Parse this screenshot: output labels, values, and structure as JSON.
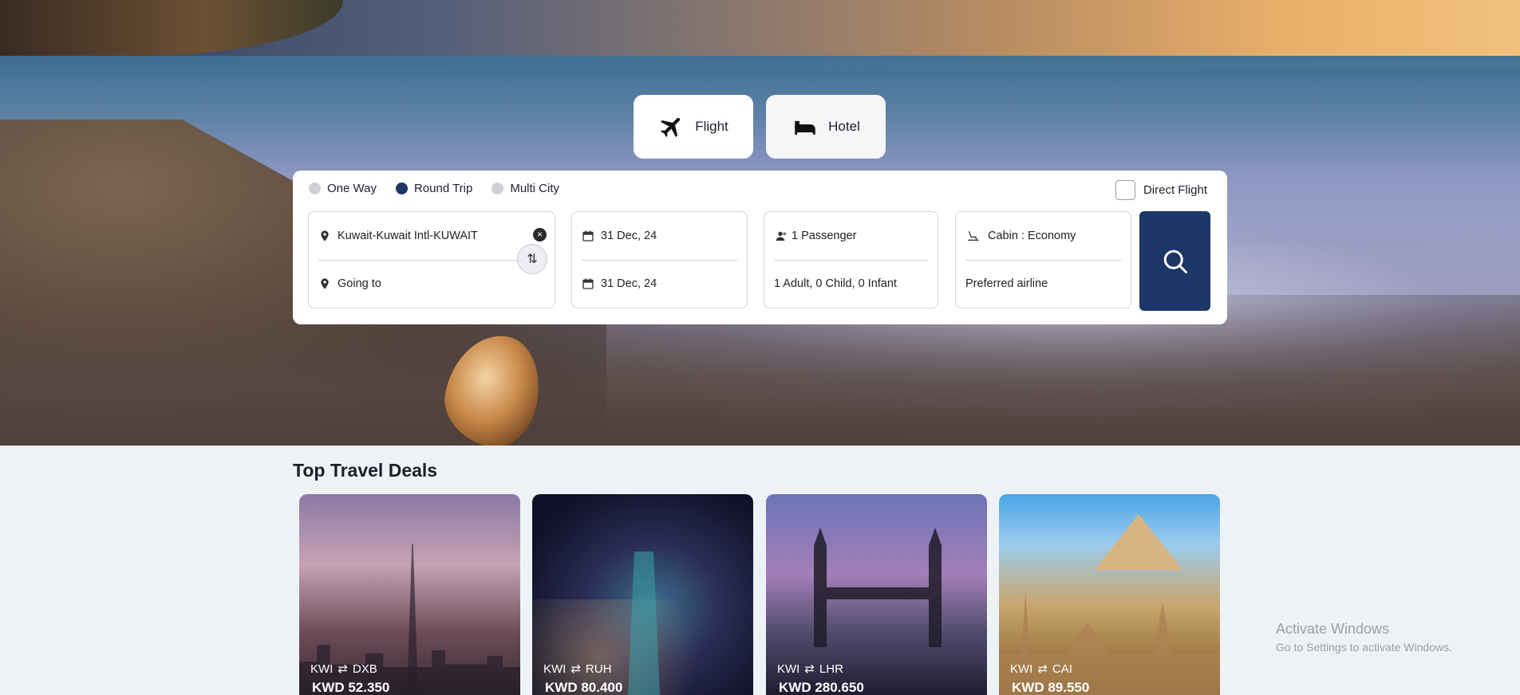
{
  "tabs": {
    "flight_label": "Flight",
    "hotel_label": "Hotel"
  },
  "search": {
    "trip_types": [
      "One Way",
      "Round Trip",
      "Multi City"
    ],
    "selected_trip_type": "Round Trip",
    "direct_flight_label": "Direct Flight",
    "from_value": "Kuwait-Kuwait Intl-KUWAIT",
    "to_placeholder": "Going to",
    "depart_date": "31 Dec, 24",
    "return_date": "31 Dec, 24",
    "passengers": "1 Passenger",
    "passenger_breakdown": "1 Adult, 0 Child, 0 Infant",
    "cabin": "Cabin :  Economy",
    "preferred_airline_placeholder": "Preferred airline"
  },
  "deals": {
    "title": "Top Travel Deals",
    "items": [
      {
        "from": "KWI",
        "to": "DXB",
        "price": "KWD 52.350"
      },
      {
        "from": "KWI",
        "to": "RUH",
        "price": "KWD 80.400"
      },
      {
        "from": "KWI",
        "to": "LHR",
        "price": "KWD 280.650"
      },
      {
        "from": "KWI",
        "to": "CAI",
        "price": "KWD 89.550"
      }
    ]
  },
  "watermark": {
    "title": "Activate Windows",
    "subtitle": "Go to Settings to activate Windows."
  },
  "colors": {
    "accent": "#1c3667",
    "page_bg": "#eef2f6"
  }
}
